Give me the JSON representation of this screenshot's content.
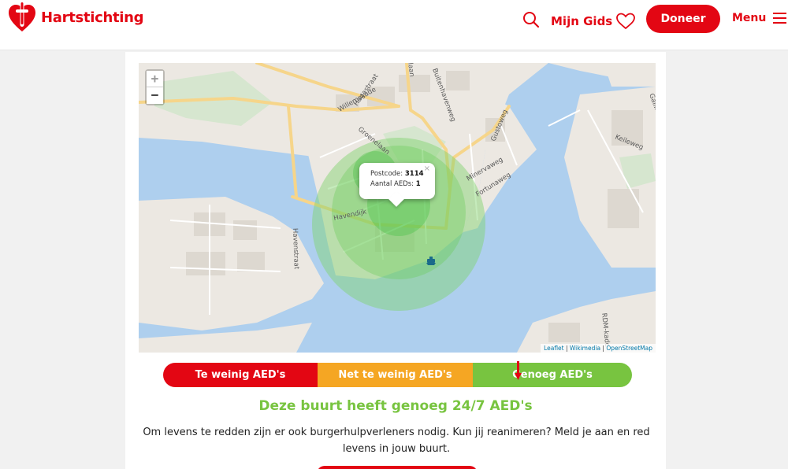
{
  "header": {
    "brand": "Hartstichting",
    "mijn_gids_label": "Mijn Gids",
    "doneer_label": "Doneer",
    "menu_label": "Menu",
    "brand_color": "#e30613"
  },
  "map": {
    "zoom_in": "+",
    "zoom_out": "−",
    "streets": [
      "Willemskade",
      "Hagastraat",
      "Groenelaan",
      "Buitenhavenweg",
      "Gustoweg",
      "Minervaweg",
      "Fortunaweg",
      "Havendijk",
      "Havenstraat",
      "Keileweg",
      "Gallileweg",
      "RDM-kade",
      "laan"
    ],
    "popup": {
      "postcode_label": "Postcode:",
      "postcode_value": "3114",
      "aeds_label": "Aantal AEDs:",
      "aeds_value": "1",
      "close": "×"
    },
    "attribution": {
      "leaflet": "Leaflet",
      "sep1": " | ",
      "wikimedia": "Wikimedia",
      "sep2": " | ",
      "osm": "OpenStreetMap"
    },
    "icons": [
      "search-icon",
      "heart-icon",
      "hamburger-icon",
      "ferry-icon"
    ]
  },
  "scale": {
    "low": "Te weinig AED's",
    "mid": "Net te weinig AED's",
    "high": "Genoeg AED's",
    "colors": {
      "low": "#e30613",
      "mid": "#f5a623",
      "high": "#78c440"
    }
  },
  "result": {
    "title": "Deze buurt heeft genoeg 24/7 AED's",
    "text": "Om levens te redden zijn er ook burgerhulpverleners nodig. Kun jij reanimeren? Meld je aan en red levens in jouw buurt."
  }
}
